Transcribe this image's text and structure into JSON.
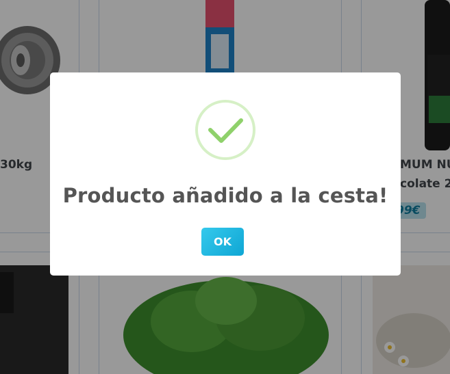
{
  "products_top": [
    {
      "name": "30kg"
    },
    {
      "name_line1": "MUM NU",
      "name_line2": "colate 2.",
      "price": "99€"
    }
  ],
  "dialog": {
    "title": "Producto añadido a la cesta!",
    "ok_label": "OK"
  },
  "colors": {
    "accent": "#1ab3de",
    "success": "#8fd16b",
    "badge_bg": "#b9e3ee"
  }
}
